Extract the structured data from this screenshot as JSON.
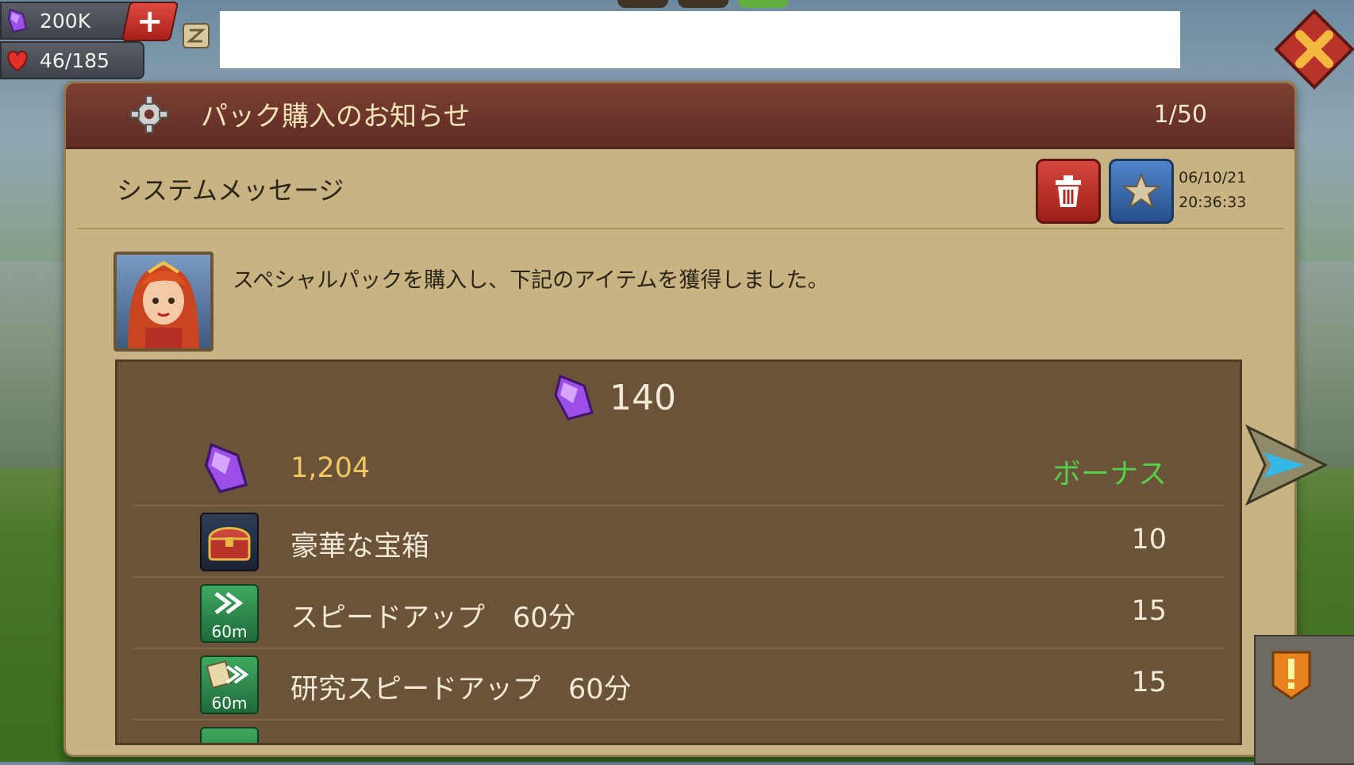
{
  "hud": {
    "gems": "200K",
    "life": "46/185",
    "plus_label": "+"
  },
  "colors": {
    "title_bar": "#6d352b",
    "panel": "#c8b383",
    "items_panel": "#6a5339",
    "bonus_green": "#55d04a",
    "gem_purple": "#9b4fe6"
  },
  "dialog": {
    "title": "パック購入のお知らせ",
    "counter": "1/50",
    "sender": "システムメッセージ",
    "date": "06/10/21",
    "time": "20:36:33",
    "message": "スペシャルパックを購入し、下記のアイテムを獲得しました。"
  },
  "items": {
    "main_gems": "140",
    "rows": [
      {
        "icon": "gem-icon",
        "label": "1,204",
        "qty": "ボーナス"
      },
      {
        "icon": "treasure-chest-icon",
        "label": "豪華な宝箱",
        "qty": "10"
      },
      {
        "icon": "speedup-icon",
        "tile_text": "60m",
        "label": "スピードアップ　60分",
        "qty": "15"
      },
      {
        "icon": "research-speedup-icon",
        "tile_text": "60m",
        "label": "研究スピードアップ　60分",
        "qty": "15"
      }
    ]
  },
  "icons": [
    "gear-icon",
    "trash-icon",
    "star-icon",
    "close-icon",
    "next-arrow-icon",
    "scroll-icon",
    "heart-icon",
    "gem-icon"
  ]
}
